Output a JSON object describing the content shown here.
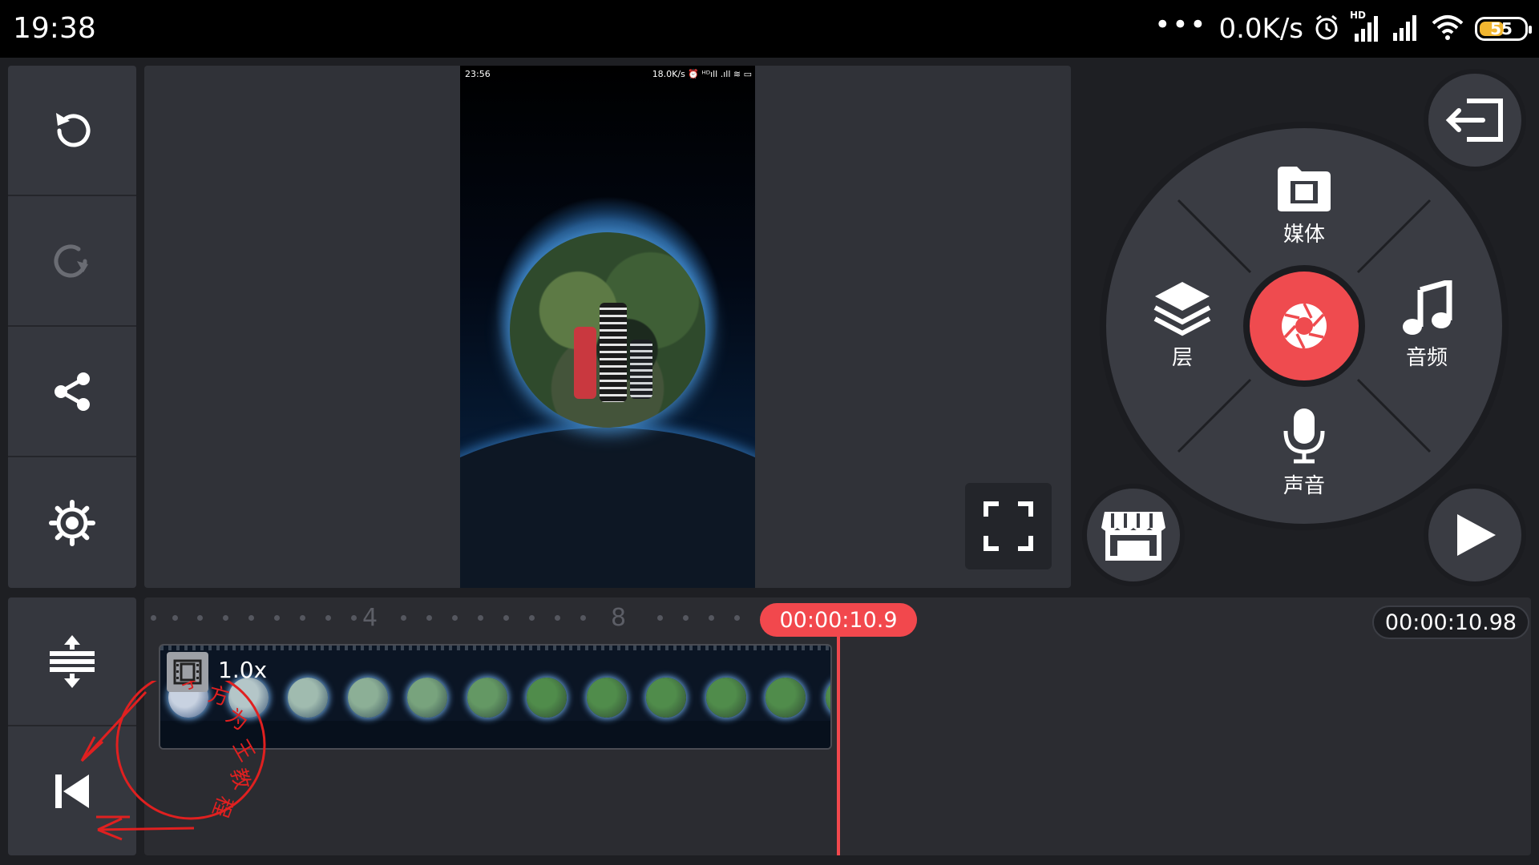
{
  "status_bar": {
    "time": "19:38",
    "dots": "•••",
    "net_speed": "0.0K/s",
    "network_badge": "HD",
    "battery": "55",
    "battery_level": 0.55,
    "icons": [
      "alarm-icon",
      "hd-signal-icon",
      "signal-icon",
      "wifi-icon",
      "battery-icon"
    ]
  },
  "left_toolbar": {
    "items": [
      {
        "name": "undo",
        "icon": "undo-icon",
        "enabled": true
      },
      {
        "name": "redo",
        "icon": "redo-icon",
        "enabled": false
      },
      {
        "name": "share",
        "icon": "share-icon",
        "enabled": true
      },
      {
        "name": "settings",
        "icon": "gear-icon",
        "enabled": true
      }
    ]
  },
  "preview": {
    "inner_time": "23:56",
    "inner_status": "18.0K/s ⏰ ᴴᴰıll .ıll ≋ ▭",
    "fullscreen_icon": "fullscreen-icon"
  },
  "radial_menu": {
    "media": "媒体",
    "layer": "层",
    "audio": "音频",
    "voice": "声音",
    "record_icon": "camera-shutter-icon"
  },
  "right_buttons": {
    "exit_icon": "exit-icon",
    "store_icon": "store-icon",
    "play_icon": "play-icon"
  },
  "timeline": {
    "ruler_numbers": [
      "4",
      "8"
    ],
    "playhead_time": "00:00:10.9",
    "total_time": "00:00:10.98",
    "clip_speed": "1.0x",
    "tools": [
      {
        "name": "timeline-expand",
        "icon": "expand-vertical-icon"
      },
      {
        "name": "jump-to-start",
        "icon": "skip-to-start-icon"
      }
    ]
  },
  "watermark": {
    "text": "学方为王教程"
  },
  "colors": {
    "accent": "#ef4b4f",
    "panel": "#35373e",
    "background": "#1e1f23"
  }
}
